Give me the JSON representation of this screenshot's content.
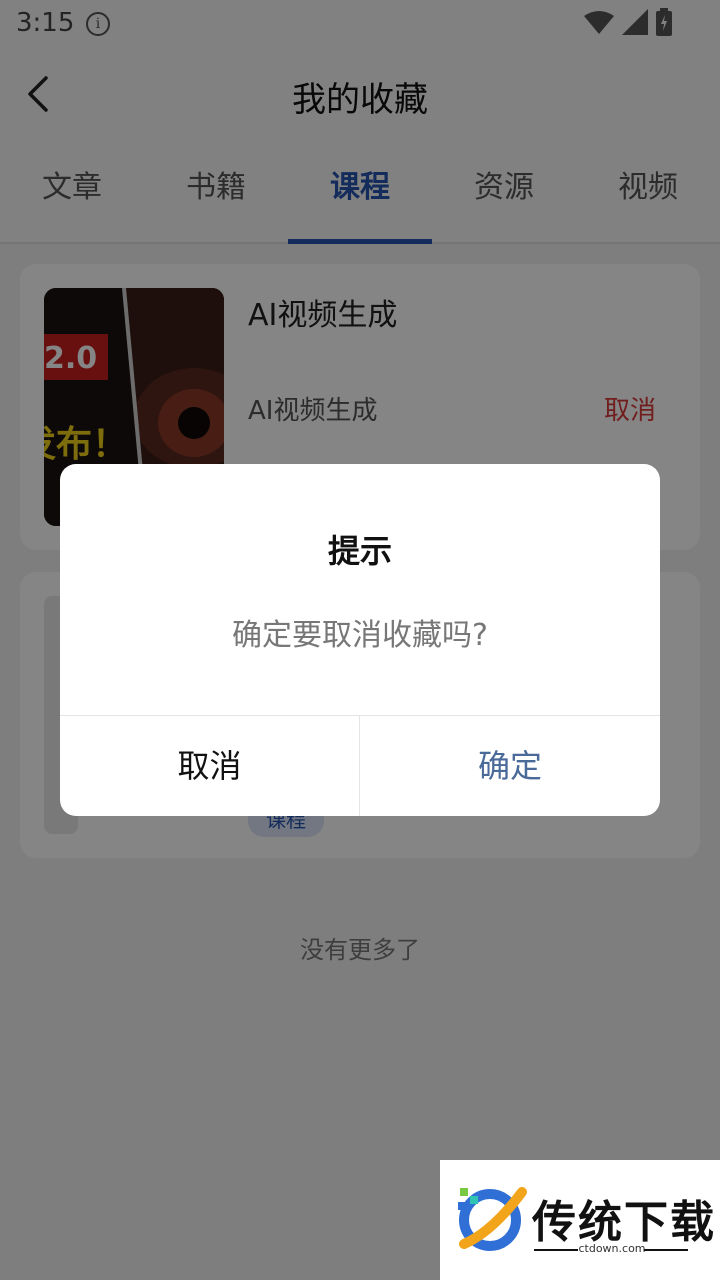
{
  "status": {
    "time": "3:15"
  },
  "header": {
    "title": "我的收藏"
  },
  "tabs": [
    {
      "label": "文章",
      "active": false
    },
    {
      "label": "书籍",
      "active": false
    },
    {
      "label": "课程",
      "active": true
    },
    {
      "label": "资源",
      "active": false
    },
    {
      "label": "视频",
      "active": false
    }
  ],
  "items": [
    {
      "title": "AI视频生成",
      "subtitle": "AI视频生成",
      "action": "取消",
      "thumb_text_badge": "2.0",
      "thumb_text_caption": "发布！"
    },
    {
      "tag": "课程"
    }
  ],
  "footer": {
    "no_more": "没有更多了"
  },
  "dialog": {
    "title": "提示",
    "message": "确定要取消收藏吗?",
    "cancel": "取消",
    "confirm": "确定"
  },
  "watermark": {
    "name": "传统下载",
    "url": "ctdown.com"
  },
  "colors": {
    "accent": "#2855b0",
    "danger": "#d93a3a",
    "confirm": "#4a6a99"
  }
}
